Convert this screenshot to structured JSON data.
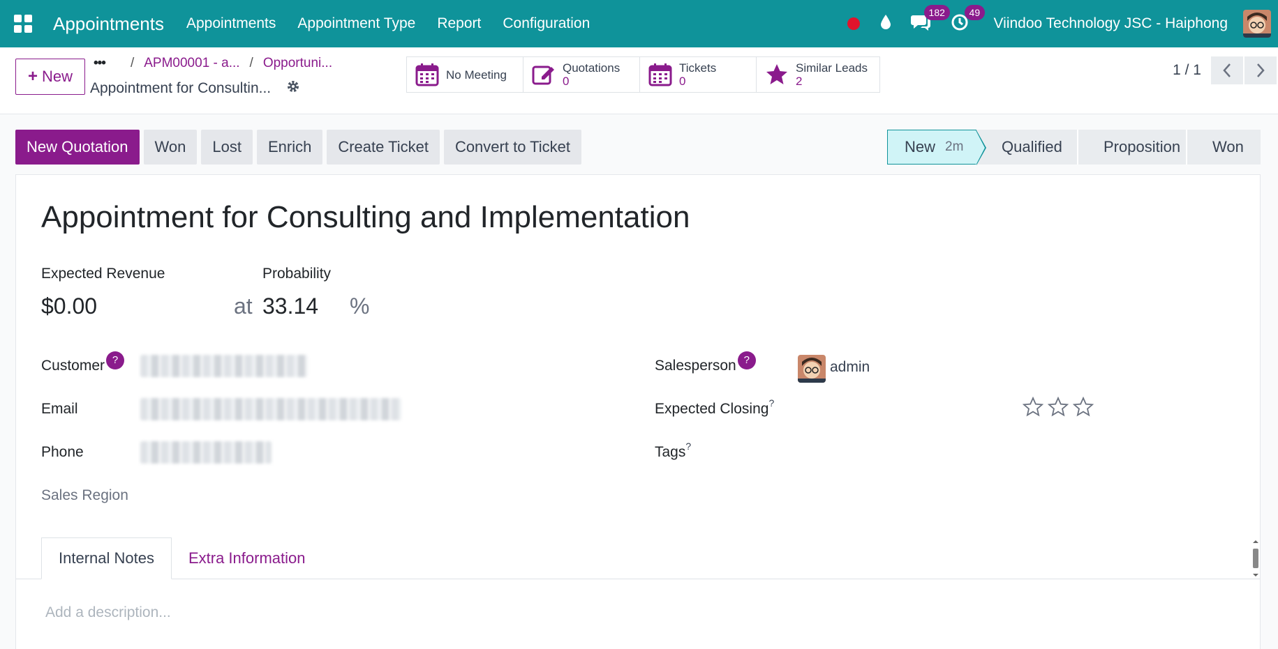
{
  "topbar": {
    "app_title": "Appointments",
    "menu": [
      "Appointments",
      "Appointment Type",
      "Report",
      "Configuration"
    ],
    "chat_count": "182",
    "activity_count": "49",
    "company": "Viindoo Technology JSC - Haiphong"
  },
  "control": {
    "new_label": "New",
    "breadcrumb_dots": "•••",
    "breadcrumb": [
      "APM00001 - a...",
      "Opportuni..."
    ],
    "record_title": "Appointment for Consultin...",
    "smart_buttons": [
      {
        "label": "No Meeting",
        "value": ""
      },
      {
        "label": "Quotations",
        "value": "0"
      },
      {
        "label": "Tickets",
        "value": "0"
      },
      {
        "label": "Similar Leads",
        "value": "2"
      }
    ],
    "pager": "1 / 1"
  },
  "actions": [
    "New Quotation",
    "Won",
    "Lost",
    "Enrich",
    "Create Ticket",
    "Convert to Ticket"
  ],
  "stages": {
    "current": "New",
    "current_time": "2m",
    "others": [
      "Qualified",
      "Proposition",
      "Won"
    ]
  },
  "form": {
    "title": "Appointment for Consulting and Implementation",
    "expected_revenue_label": "Expected Revenue",
    "expected_revenue": "$0.00",
    "at": "at",
    "probability_label": "Probability",
    "probability": "33.14",
    "percent": "%",
    "customer_label": "Customer",
    "email_label": "Email",
    "phone_label": "Phone",
    "sales_region_label": "Sales Region",
    "salesperson_label": "Salesperson",
    "salesperson": "admin",
    "expected_closing_label": "Expected Closing",
    "tags_label": "Tags",
    "help_mark": "?",
    "priority_stars": 0,
    "tabs": [
      "Internal Notes",
      "Extra Information"
    ],
    "description_placeholder": "Add a description..."
  },
  "colors": {
    "navbar": "#0f939a",
    "primary": "#8a1b8c",
    "stage_active": "#d0f4f7"
  }
}
